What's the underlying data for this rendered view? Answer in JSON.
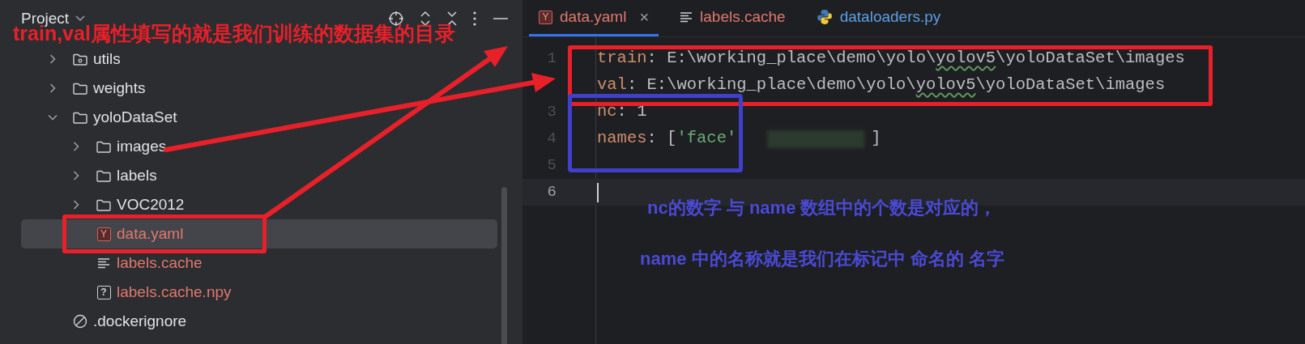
{
  "project_panel": {
    "title": "Project",
    "tree": [
      {
        "kind": "package",
        "label": "utils",
        "expanded": false,
        "selected": false,
        "untracked": false
      },
      {
        "kind": "folder",
        "label": "weights",
        "expanded": false,
        "selected": false,
        "untracked": false
      },
      {
        "kind": "folder",
        "label": "yoloDataSet",
        "expanded": true,
        "selected": false,
        "untracked": false,
        "children": [
          {
            "kind": "folder",
            "label": "images",
            "expanded": false,
            "selected": false,
            "untracked": false
          },
          {
            "kind": "folder",
            "label": "labels",
            "expanded": false,
            "selected": false,
            "untracked": false
          },
          {
            "kind": "folder",
            "label": "VOC2012",
            "expanded": false,
            "selected": false,
            "untracked": false
          },
          {
            "kind": "yaml",
            "badge": "Y",
            "label": "data.yaml",
            "untracked": true,
            "selected": true
          },
          {
            "kind": "text",
            "label": "labels.cache",
            "untracked": true,
            "selected": false
          },
          {
            "kind": "unknown",
            "badge": "?",
            "label": "labels.cache.npy",
            "untracked": true,
            "selected": false
          }
        ]
      },
      {
        "kind": "ignore",
        "label": ".dockerignore",
        "selected": false,
        "untracked": false
      }
    ]
  },
  "editor": {
    "tabs": [
      {
        "kind": "yaml",
        "badge": "Y",
        "label": "data.yaml",
        "untracked": true,
        "modified": false,
        "selected": true,
        "close": "×"
      },
      {
        "kind": "text",
        "label": "labels.cache",
        "untracked": true,
        "modified": false,
        "selected": false
      },
      {
        "kind": "python",
        "label": "dataloaders.py",
        "untracked": false,
        "modified": true,
        "selected": false
      }
    ],
    "lines": [
      {
        "number": "1",
        "current": false,
        "tokens": [
          {
            "kind": "key",
            "text": "train"
          },
          {
            "kind": "punct",
            "text": ": "
          },
          {
            "kind": "plain",
            "text": "E:\\working_place\\demo\\yolo\\"
          },
          {
            "kind": "plain",
            "text": "yolov5",
            "typo": true
          },
          {
            "kind": "plain",
            "text": "\\yoloDataSet\\images"
          }
        ]
      },
      {
        "current": false,
        "tokens": [
          {
            "kind": "key",
            "text": "val"
          },
          {
            "kind": "punct",
            "text": ": "
          },
          {
            "kind": "plain",
            "text": "E:\\working_place\\demo\\yolo\\"
          },
          {
            "kind": "plain",
            "text": "yolov5",
            "typo": true
          },
          {
            "kind": "plain",
            "text": "\\yoloDataSet\\images"
          }
        ]
      },
      {
        "number": "3",
        "current": false,
        "tokens": [
          {
            "kind": "key",
            "text": "nc"
          },
          {
            "kind": "punct",
            "text": ": "
          },
          {
            "kind": "plain",
            "text": "1"
          }
        ]
      },
      {
        "number": "4",
        "current": false,
        "tokens": [
          {
            "kind": "key",
            "text": "names"
          },
          {
            "kind": "punct",
            "text": ": ["
          },
          {
            "kind": "string",
            "text": "'face'"
          },
          {
            "kind": "redacted"
          },
          {
            "kind": "punct",
            "text": "]"
          }
        ]
      },
      {
        "number": "5",
        "current": false
      },
      {
        "number": "6",
        "current": true
      }
    ]
  },
  "annotations": {
    "heading": {
      "text": "train,val属性填写的就是我们训练的数据集的目录"
    },
    "notes": [
      {
        "text": "nc的数字 与 name 数组中的个数是对应的，"
      },
      {
        "text": "name 中的名称就是我们在标记中 命名的 名字"
      }
    ]
  }
}
